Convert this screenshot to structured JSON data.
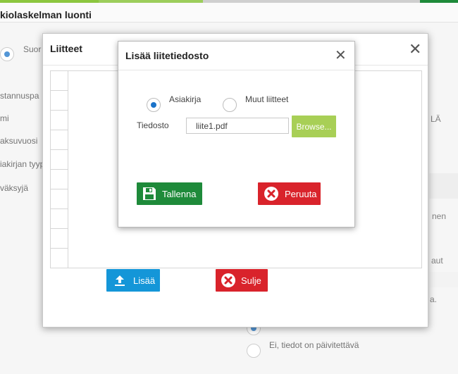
{
  "topbar_colors": [
    "#8cc63f",
    "#8cc63f",
    "#cfcfcf",
    "#cfcfcf",
    "#1e8a3a"
  ],
  "background": {
    "page_title": "kiolaskelman luonti",
    "radio_label": "Suor",
    "left_labels": [
      "stannuspa",
      "mi",
      "aksuvuosi",
      "iakirjan tyyp",
      "väksyjä"
    ],
    "right_labels": [
      "LÄ",
      "nen",
      "aut",
      "a."
    ],
    "bottom_option": "Ei, tiedot on päivitettävä"
  },
  "attachments_dialog": {
    "title": "Liitteet",
    "add_label": "Lisää",
    "close_label": "Sulje"
  },
  "upload_dialog": {
    "title": "Lisää liitetiedosto",
    "options": [
      {
        "label": "Asiakirja",
        "checked": true
      },
      {
        "label": "Muut liitteet",
        "checked": false
      }
    ],
    "file_label": "Tiedosto",
    "file_value": "liite1.pdf",
    "browse_label": "Browse...",
    "save_label": "Tallenna",
    "cancel_label": "Peruuta"
  },
  "colors": {
    "save_green": "#1e8a3a",
    "cancel_red": "#d9232b",
    "add_blue": "#1496d8",
    "browse_green": "#a8cf56",
    "radio_blue": "#1a73c9"
  }
}
